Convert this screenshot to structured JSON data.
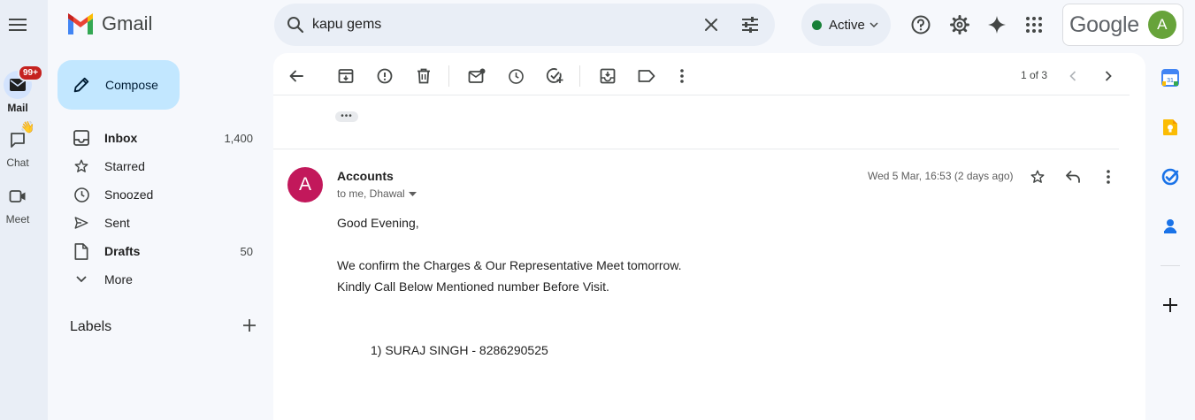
{
  "app": {
    "name": "Gmail"
  },
  "search": {
    "query": "kapu gems"
  },
  "status": {
    "label": "Active",
    "color": "#188038"
  },
  "account": {
    "brand": "Google",
    "initial": "A",
    "avatar_color": "#67a33a"
  },
  "rail": {
    "items": [
      {
        "label": "Mail",
        "icon": "mail-icon",
        "badge": "99+"
      },
      {
        "label": "Chat",
        "icon": "chat-icon"
      },
      {
        "label": "Meet",
        "icon": "video-icon"
      }
    ]
  },
  "compose": {
    "label": "Compose"
  },
  "nav": {
    "items": [
      {
        "label": "Inbox",
        "count": "1,400",
        "icon": "inbox-icon"
      },
      {
        "label": "Starred",
        "count": "",
        "icon": "star-icon"
      },
      {
        "label": "Snoozed",
        "count": "",
        "icon": "clock-icon"
      },
      {
        "label": "Sent",
        "count": "",
        "icon": "send-icon"
      },
      {
        "label": "Drafts",
        "count": "50",
        "icon": "draft-icon"
      },
      {
        "label": "More",
        "count": "",
        "icon": "chevron-down-icon"
      }
    ]
  },
  "labels": {
    "heading": "Labels"
  },
  "pager": {
    "text": "1 of 3"
  },
  "message": {
    "ellipsis": "•••",
    "sender": "Accounts",
    "sender_initial": "A",
    "sender_color": "#c2185b",
    "recipients": "to me, Dhawal",
    "date": "Wed 5 Mar, 16:53 (2 days ago)",
    "body": {
      "greeting": "Good Evening,",
      "line1": "We confirm the Charges & Our Representative Meet tomorrow.",
      "line2": "Kindly Call Below Mentioned number Before Visit.",
      "contact": "1) SURAJ SINGH - 8286290525"
    }
  }
}
